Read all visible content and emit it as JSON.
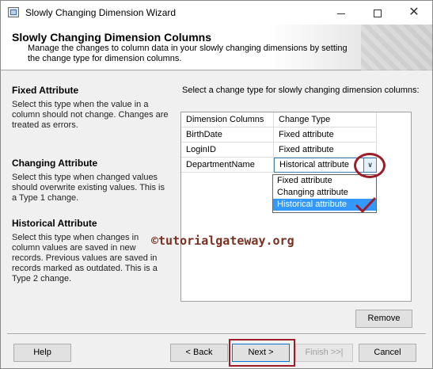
{
  "window": {
    "title": "Slowly Changing Dimension Wizard",
    "minimize": "",
    "maximize": "",
    "close": "✕"
  },
  "header": {
    "title": "Slowly Changing Dimension Columns",
    "description": "Manage the changes to column data in your slowly changing dimensions by setting the change type for dimension columns."
  },
  "sidebar": [
    {
      "title": "Fixed Attribute",
      "text": "Select this type when the value in a column should not change. Changes are treated as errors."
    },
    {
      "title": "Changing Attribute",
      "text": "Select this type when changed values should overwrite existing values. This is a Type 1 change."
    },
    {
      "title": "Historical Attribute",
      "text": "Select this type when changes in column values are saved in new records. Previous values are saved in records marked as outdated. This is a Type 2 change."
    }
  ],
  "main": {
    "prompt": "Select a change type for slowly changing dimension columns:",
    "columns": [
      "Dimension Columns",
      "Change Type"
    ],
    "rows": [
      {
        "column": "BirthDate",
        "type": "Fixed attribute"
      },
      {
        "column": "LoginID",
        "type": "Fixed attribute"
      },
      {
        "column": "DepartmentName",
        "type": "Historical attribute"
      }
    ],
    "dropdown_options": [
      "Fixed attribute",
      "Changing attribute",
      "Historical attribute"
    ],
    "selected_option": "Historical attribute"
  },
  "watermark": "©tutorialgateway.org",
  "buttons": {
    "remove": "Remove",
    "help": "Help",
    "back": "< Back",
    "next": "Next >",
    "finish": "Finish >>|",
    "cancel": "Cancel"
  },
  "colors": {
    "annotation": "#9d1c28",
    "selection": "#3399ff"
  }
}
